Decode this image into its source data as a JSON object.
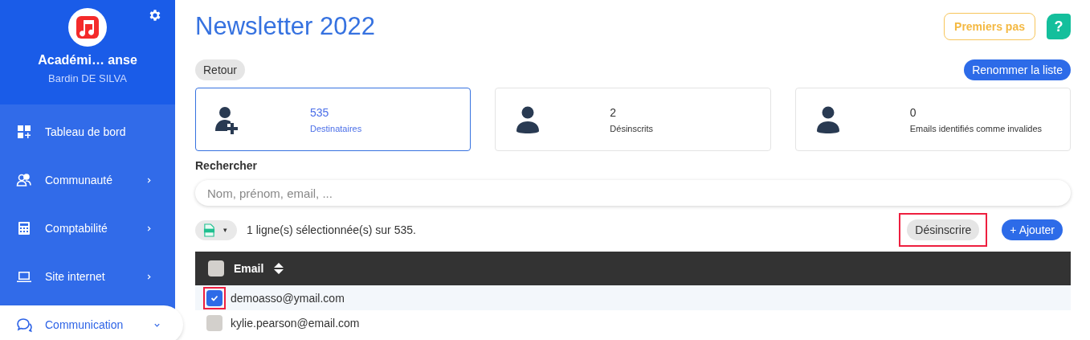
{
  "sidebar": {
    "org_name": "Académi… anse",
    "user_name": "Bardin DE SILVA",
    "items": [
      {
        "kind": "dashboard",
        "label": "Tableau de bord",
        "selected": false
      },
      {
        "kind": "people",
        "label": "Communauté",
        "selected": false,
        "expanded": false
      },
      {
        "kind": "calculator",
        "label": "Comptabilité",
        "selected": false,
        "expanded": false
      },
      {
        "kind": "laptop",
        "label": "Site internet",
        "selected": false,
        "expanded": false
      },
      {
        "kind": "chat",
        "label": "Communication",
        "selected": true,
        "expanded": true
      }
    ]
  },
  "header": {
    "title": "Newsletter 2022",
    "first_steps": "Premiers pas",
    "help": "?"
  },
  "back_button": "Retour",
  "rename_button": "Renommer la liste",
  "stats": [
    {
      "kind": "add",
      "value": "535",
      "label": "Destinataires",
      "selected": true
    },
    {
      "kind": "person",
      "value": "2",
      "label": "Désinscrits",
      "selected": false
    },
    {
      "kind": "person",
      "value": "0",
      "label": "Emails identifiés comme invalides",
      "selected": false
    }
  ],
  "search": {
    "label": "Rechercher",
    "placeholder": "Nom, prénom, email, ..."
  },
  "toolbar": {
    "export_caret": "▾",
    "selection_text": "1 ligne(s) sélectionnée(s) sur 535.",
    "actions": [
      {
        "kind": "secondary",
        "label": "Désinscrire",
        "highlighted": true
      },
      {
        "kind": "primary",
        "label": "+ Ajouter",
        "highlighted": false
      }
    ]
  },
  "table": {
    "columns": [
      {
        "label": "Email",
        "checked": false
      }
    ],
    "rows": [
      {
        "email": "demoasso@ymail.com",
        "checked": true,
        "highlighted": true
      },
      {
        "email": "kylie.pearson@email.com",
        "checked": false,
        "highlighted": false
      }
    ]
  }
}
